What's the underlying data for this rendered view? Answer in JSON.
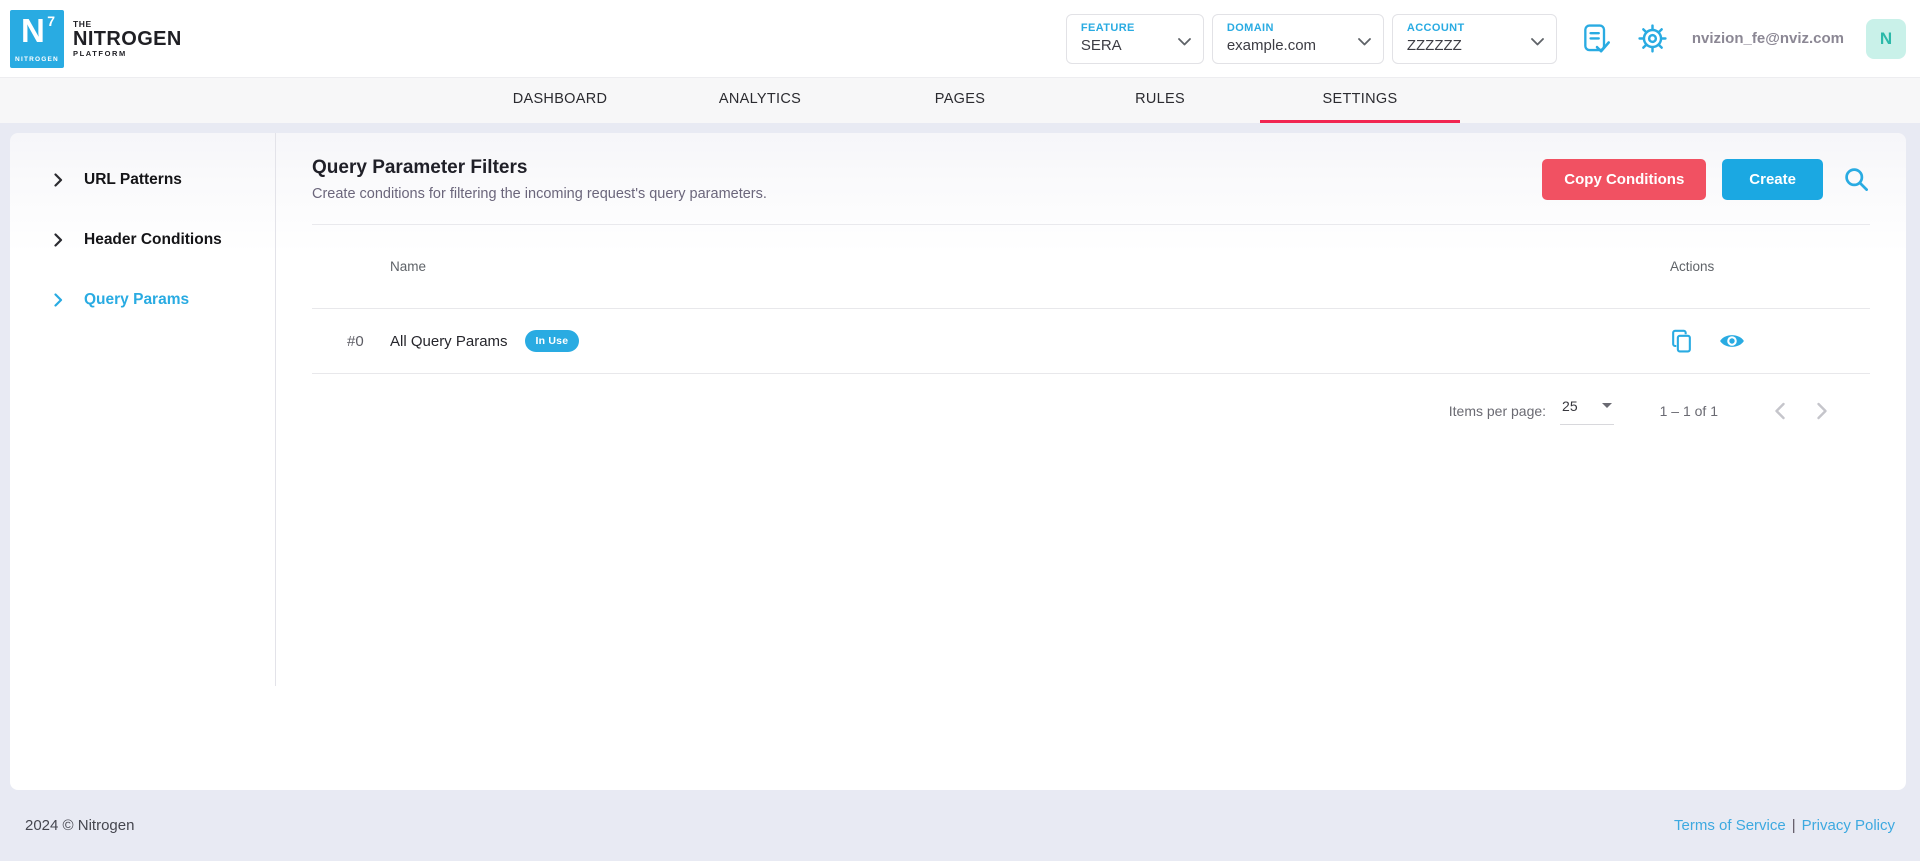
{
  "header": {
    "logo": {
      "symbol": "N",
      "superscript": "7",
      "cube_word": "NITROGEN",
      "brand_line1": "THE",
      "brand_line2": "NITROGEN",
      "brand_line3": "PLATFORM"
    },
    "selectors": [
      {
        "label": "FEATURE",
        "value": "SERA"
      },
      {
        "label": "DOMAIN",
        "value": "example.com"
      },
      {
        "label": "ACCOUNT",
        "value": "ZZZZZZ"
      }
    ],
    "user_email": "nvizion_fe@nviz.com",
    "avatar_initial": "N"
  },
  "nav": {
    "tabs": [
      {
        "label": "DASHBOARD"
      },
      {
        "label": "ANALYTICS"
      },
      {
        "label": "PAGES"
      },
      {
        "label": "RULES"
      },
      {
        "label": "SETTINGS"
      }
    ],
    "active_tab": "SETTINGS"
  },
  "sidebar": {
    "items": [
      {
        "label": "URL Patterns"
      },
      {
        "label": "Header Conditions"
      },
      {
        "label": "Query Params"
      }
    ],
    "active_item": "Query Params"
  },
  "main": {
    "title": "Query Parameter Filters",
    "subtitle": "Create conditions for filtering the incoming request's query parameters.",
    "buttons": {
      "copy_conditions": "Copy Conditions",
      "create": "Create"
    },
    "table": {
      "columns": {
        "name": "Name",
        "actions": "Actions"
      },
      "rows": [
        {
          "index": "#0",
          "name": "All Query Params",
          "badge": "In Use"
        }
      ]
    },
    "pagination": {
      "items_per_page_label": "Items per page:",
      "items_per_page_value": "25",
      "range_label": "1 – 1 of 1"
    }
  },
  "footer": {
    "copyright": "2024 © Nitrogen",
    "link_terms": "Terms of Service",
    "separator": "|",
    "link_privacy": "Privacy Policy"
  },
  "colors": {
    "brand_cyan": "#29ABE2",
    "create_button": "#1BA8E2",
    "copy_button_pink": "#F15162",
    "tab_underline": "#F12551",
    "badge_in_use": "#29ABE2",
    "page_background": "#E8EAF3",
    "avatar_background": "#C9F1E9",
    "avatar_text": "#2BB9A9"
  }
}
